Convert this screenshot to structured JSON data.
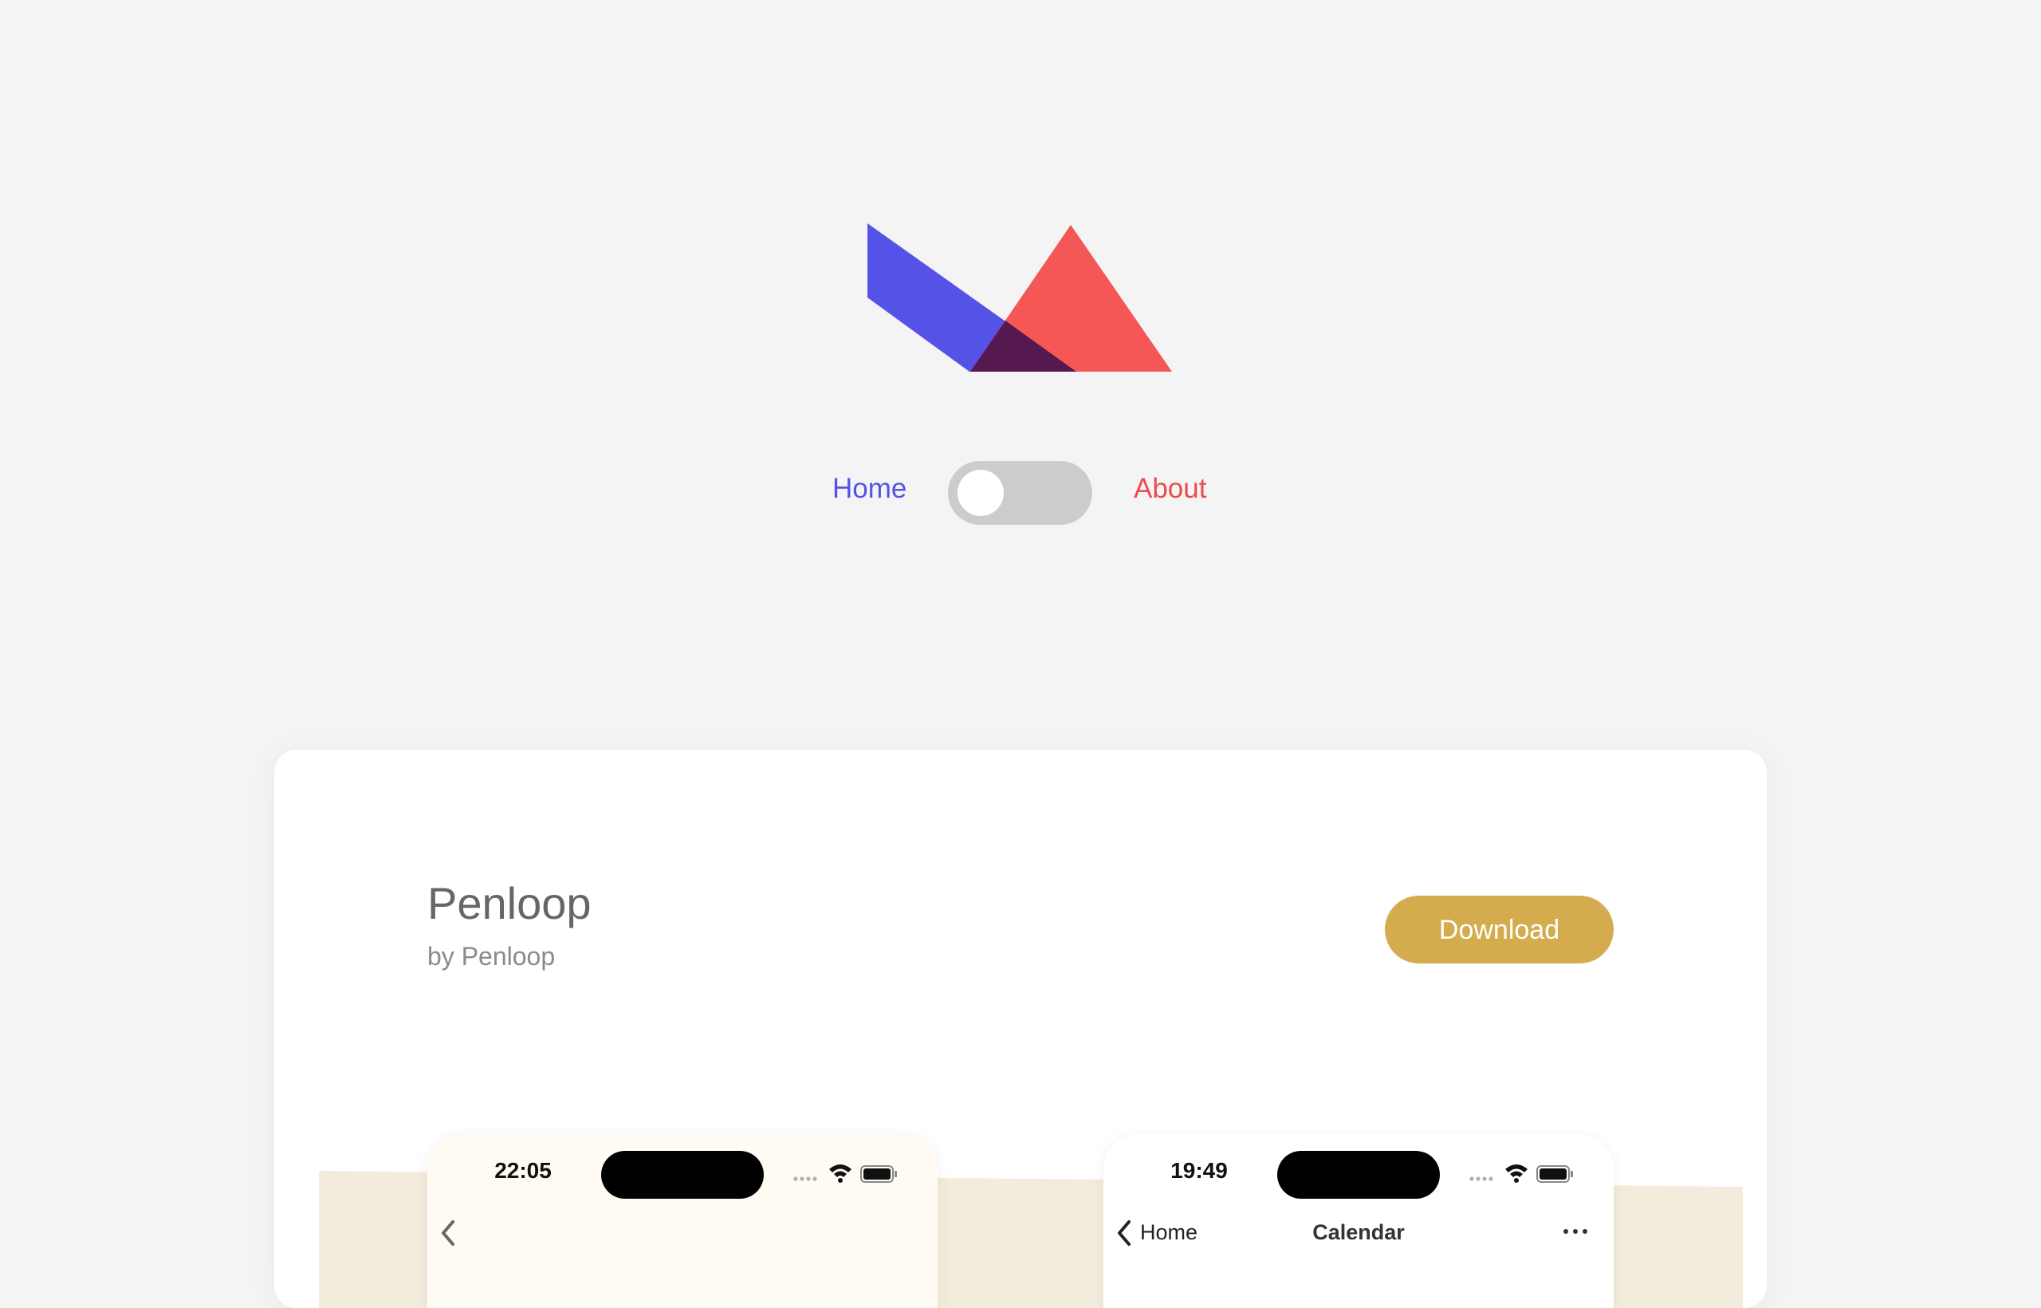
{
  "brand": {
    "logo_icon": "triangles-logo-icon",
    "colors": {
      "blue": "#5552e8",
      "red": "#f55656",
      "overlap": "#55194f"
    }
  },
  "nav": {
    "home_label": "Home",
    "about_label": "About",
    "toggle_state": "off"
  },
  "app": {
    "name": "Penloop",
    "author": "by Penloop",
    "download_label": "Download",
    "accent_color": "#d4ac4e"
  },
  "screenshots": [
    {
      "time": "22:05",
      "back_icon": "chevron-left-icon"
    },
    {
      "time": "19:49",
      "back_label": "Home",
      "title": "Calendar",
      "more_icon": "ellipsis-icon"
    }
  ]
}
